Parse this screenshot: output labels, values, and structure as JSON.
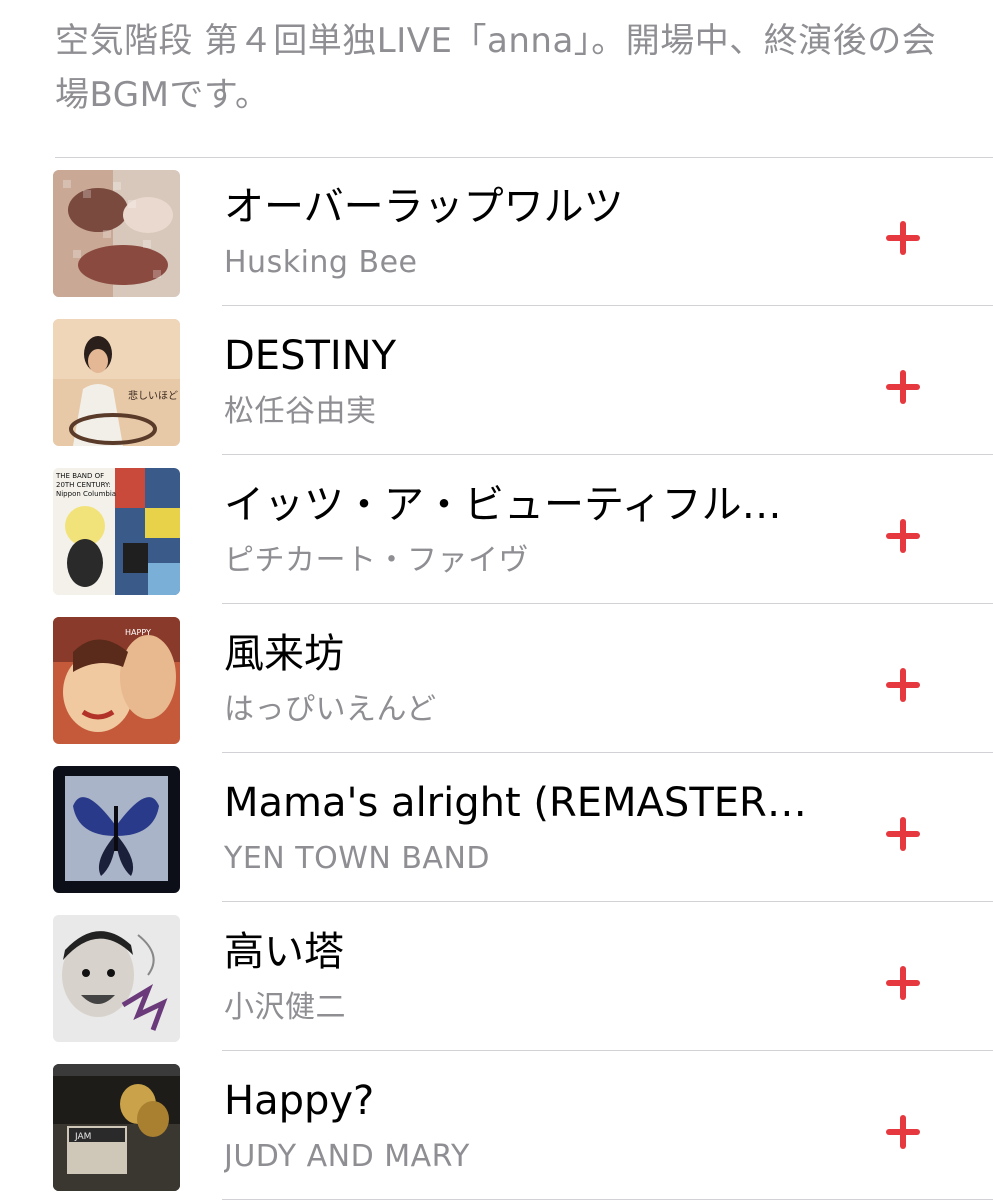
{
  "playlist": {
    "description": "空気階段 第４回単独LIVE「anna」。開場中、終演後の会場BGMです。"
  },
  "accent_color": "#e5393f",
  "tracks": [
    {
      "title": "オーバーラップワルツ",
      "artist": "Husking Bee",
      "add_icon": "plus-icon"
    },
    {
      "title": "DESTINY",
      "artist": "松任谷由実",
      "add_icon": "plus-icon"
    },
    {
      "title": "イッツ・ア・ビューティフル…",
      "artist": "ピチカート・ファイヴ",
      "add_icon": "plus-icon"
    },
    {
      "title": "風来坊",
      "artist": "はっぴいえんど",
      "add_icon": "plus-icon"
    },
    {
      "title": "Mama's alright (REMASTER…",
      "artist": "YEN TOWN BAND",
      "add_icon": "plus-icon"
    },
    {
      "title": "高い塔",
      "artist": "小沢健二",
      "add_icon": "plus-icon"
    },
    {
      "title": "Happy?",
      "artist": "JUDY AND MARY",
      "add_icon": "plus-icon"
    }
  ]
}
